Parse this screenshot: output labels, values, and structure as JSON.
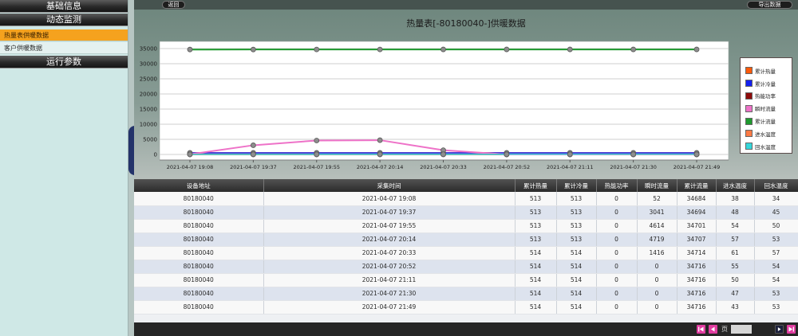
{
  "sidebar": {
    "sections": [
      {
        "title": "基础信息",
        "items": []
      },
      {
        "title": "动态监测",
        "items": [
          {
            "label": "热量表供暖数据",
            "active": true
          },
          {
            "label": "客户供暖数据",
            "active": false
          }
        ]
      },
      {
        "title": "运行参数",
        "items": []
      }
    ]
  },
  "toolbar": {
    "back_label": "返回",
    "export_label": "导出数据"
  },
  "chart_data": {
    "type": "line",
    "title": "热量表[-80180040-]供暖数据",
    "x": [
      "2021-04-07 19:08",
      "2021-04-07 19:37",
      "2021-04-07 19:55",
      "2021-04-07 20:14",
      "2021-04-07 20:33",
      "2021-04-07 20:52",
      "2021-04-07 21:11",
      "2021-04-07 21:30",
      "2021-04-07 21:49"
    ],
    "yticks": [
      0,
      5000,
      10000,
      15000,
      20000,
      25000,
      30000,
      35000
    ],
    "ylim": [
      0,
      35000
    ],
    "grid": true,
    "legend": "right",
    "series": [
      {
        "name": "累计热量",
        "color": "#ff5a0a",
        "values": [
          513,
          513,
          513,
          513,
          514,
          514,
          514,
          514,
          514
        ]
      },
      {
        "name": "累计冷量",
        "color": "#1420f0",
        "values": [
          513,
          513,
          513,
          513,
          514,
          514,
          514,
          514,
          514
        ]
      },
      {
        "name": "热能功率",
        "color": "#8e0b0b",
        "values": [
          0,
          0,
          0,
          0,
          0,
          0,
          0,
          0,
          0
        ]
      },
      {
        "name": "瞬时流量",
        "color": "#ee72c8",
        "values": [
          52,
          3041,
          4614,
          4719,
          1416,
          0,
          0,
          0,
          0
        ]
      },
      {
        "name": "累计流量",
        "color": "#1f9a2e",
        "values": [
          34684,
          34694,
          34701,
          34707,
          34714,
          34716,
          34716,
          34716,
          34716
        ]
      },
      {
        "name": "进水温度",
        "color": "#ff7b45",
        "values": [
          38,
          48,
          54,
          57,
          61,
          55,
          50,
          47,
          43
        ]
      },
      {
        "name": "回水温度",
        "color": "#35d6da",
        "values": [
          34,
          45,
          50,
          53,
          57,
          54,
          54,
          53,
          53
        ]
      }
    ]
  },
  "table": {
    "columns": [
      "设备地址",
      "采集时间",
      "累计热量",
      "累计冷量",
      "热能功率",
      "瞬时流量",
      "累计流量",
      "进水温度",
      "回水温度"
    ],
    "rows": [
      [
        "80180040",
        "2021-04-07 19:08",
        "513",
        "513",
        "0",
        "52",
        "34684",
        "38",
        "34"
      ],
      [
        "80180040",
        "2021-04-07 19:37",
        "513",
        "513",
        "0",
        "3041",
        "34694",
        "48",
        "45"
      ],
      [
        "80180040",
        "2021-04-07 19:55",
        "513",
        "513",
        "0",
        "4614",
        "34701",
        "54",
        "50"
      ],
      [
        "80180040",
        "2021-04-07 20:14",
        "513",
        "513",
        "0",
        "4719",
        "34707",
        "57",
        "53"
      ],
      [
        "80180040",
        "2021-04-07 20:33",
        "514",
        "514",
        "0",
        "1416",
        "34714",
        "61",
        "57"
      ],
      [
        "80180040",
        "2021-04-07 20:52",
        "514",
        "514",
        "0",
        "0",
        "34716",
        "55",
        "54"
      ],
      [
        "80180040",
        "2021-04-07 21:11",
        "514",
        "514",
        "0",
        "0",
        "34716",
        "50",
        "54"
      ],
      [
        "80180040",
        "2021-04-07 21:30",
        "514",
        "514",
        "0",
        "0",
        "34716",
        "47",
        "53"
      ],
      [
        "80180040",
        "2021-04-07 21:49",
        "514",
        "514",
        "0",
        "0",
        "34716",
        "43",
        "53"
      ]
    ]
  },
  "pagination": {
    "page_label": "页",
    "icons": [
      "first-page-icon",
      "prev-page-icon",
      "next-page-icon",
      "last-page-icon"
    ]
  },
  "theme": {
    "sidebar_bg": "#cfe8e6",
    "active_item": "#f5a21e",
    "header_dark": "#2b2b2b",
    "pager_button": "#e03ca0"
  }
}
